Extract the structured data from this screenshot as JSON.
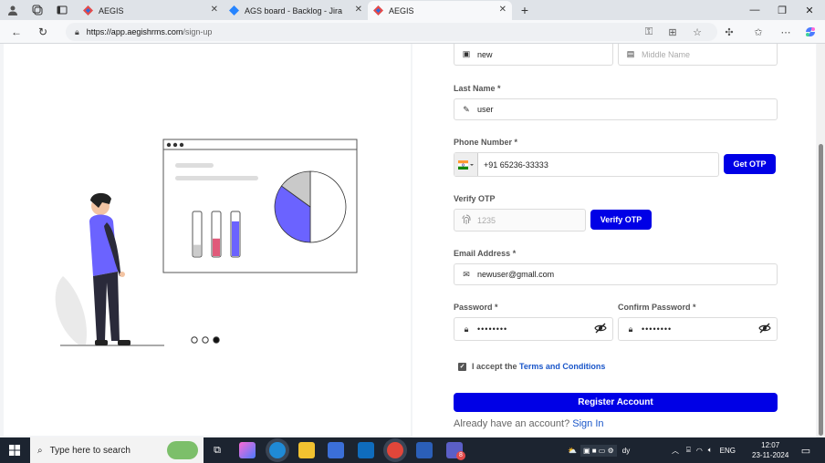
{
  "browser": {
    "tabs": [
      {
        "title": "AEGIS",
        "active": false
      },
      {
        "title": "AGS board - Backlog - Jira",
        "active": false
      },
      {
        "title": "AEGIS",
        "active": true
      }
    ],
    "url_host": "https://app.aegishrms.com",
    "url_path": "/sign-up",
    "new_tab": "+"
  },
  "carousel": {
    "dots": 3,
    "active_dot": 3
  },
  "illustration": {
    "bar_levels": [
      0.45,
      0.7,
      0.95
    ],
    "bar_colors": [
      "#cccccc",
      "#e05a7a",
      "#6b63ff"
    ],
    "pie_shares": [
      0.5,
      0.35,
      0.15
    ],
    "pie_colors": [
      "#ffffff",
      "#6b63ff",
      "#c9c9c9"
    ]
  },
  "form": {
    "first_name_value": "new",
    "middle_name_placeholder": "Middle Name",
    "last_name_label": "Last Name *",
    "last_name_value": "user",
    "phone_label": "Phone Number *",
    "phone_value": "+91 65236-33333",
    "get_otp_label": "Get OTP",
    "verify_otp_label": "Verify OTP",
    "otp_placeholder": "1235",
    "verify_otp_button": "Verify OTP",
    "email_label": "Email Address *",
    "email_value": "newuser@gmall.com",
    "password_label": "Password *",
    "password_value": "••••••••",
    "confirm_password_label": "Confirm Password *",
    "confirm_password_value": "••••••••",
    "accept_text": "I accept the",
    "terms_link": "Terms and Conditions",
    "register_button": "Register Account",
    "login_prompt": "Already have an account?",
    "login_link": "Sign In"
  },
  "taskbar": {
    "search_placeholder": "Type here to search",
    "weather_text": "dy",
    "language": "ENG",
    "time": "12:07",
    "date": "23-11-2024",
    "badge_count": "8"
  },
  "colors": {
    "primary": "#0000e6",
    "accent": "#6b63ff",
    "link": "#1a56c9"
  }
}
